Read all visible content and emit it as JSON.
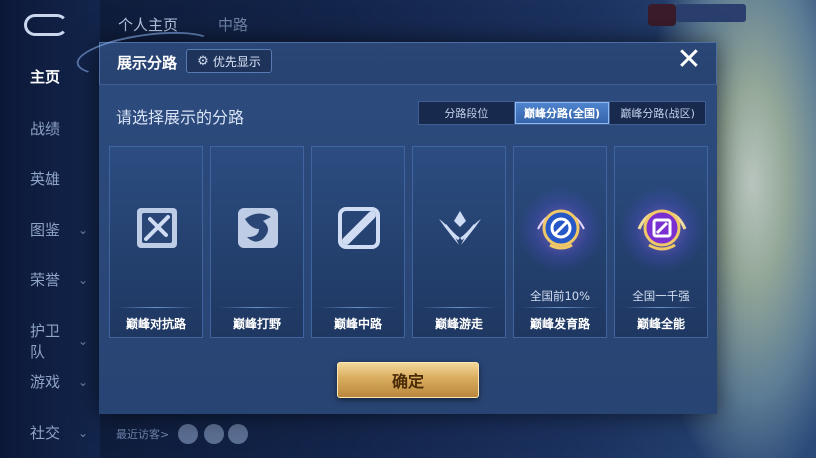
{
  "background": {
    "top_tabs": [
      "个人主页",
      "中路"
    ],
    "sidebar_items": [
      {
        "label": "主页",
        "active": true,
        "chevron": false
      },
      {
        "label": "战绩",
        "active": false,
        "chevron": false
      },
      {
        "label": "英雄",
        "active": false,
        "chevron": false
      },
      {
        "label": "图鉴",
        "active": false,
        "chevron": true
      },
      {
        "label": "荣誉",
        "active": false,
        "chevron": true
      },
      {
        "label": "护卫队",
        "active": false,
        "chevron": true
      },
      {
        "label": "游戏",
        "active": false,
        "chevron": true
      },
      {
        "label": "社交",
        "active": false,
        "chevron": true
      }
    ],
    "recent_visitors_label": "最近访客>"
  },
  "dialog": {
    "title": "展示分路",
    "priority_button": "优先显示",
    "close_icon": "close-icon",
    "prompt": "请选择展示的分路",
    "segments": [
      {
        "label": "分路段位",
        "active": false
      },
      {
        "label": "巅峰分路(全国)",
        "active": true
      },
      {
        "label": "巅峰分路(战区)",
        "active": false
      }
    ],
    "lanes": [
      {
        "label": "巅峰对抗路",
        "sub": "",
        "icon": "sword-lane-icon",
        "highlight": false
      },
      {
        "label": "巅峰打野",
        "sub": "",
        "icon": "dragon-icon",
        "highlight": false
      },
      {
        "label": "巅峰中路",
        "sub": "",
        "icon": "mid-lane-icon",
        "highlight": false
      },
      {
        "label": "巅峰游走",
        "sub": "",
        "icon": "wings-icon",
        "highlight": false
      },
      {
        "label": "巅峰发育路",
        "sub": "全国前10%",
        "icon": "blue-medal-icon",
        "highlight": true
      },
      {
        "label": "巅峰全能",
        "sub": "全国一千强",
        "icon": "purple-medal-icon",
        "highlight": true
      }
    ],
    "confirm_button": "确定"
  },
  "colors": {
    "accent_blue": "#4f84cf",
    "confirm_gold": "#d9ac5e",
    "dialog_bg": "#223b66"
  }
}
